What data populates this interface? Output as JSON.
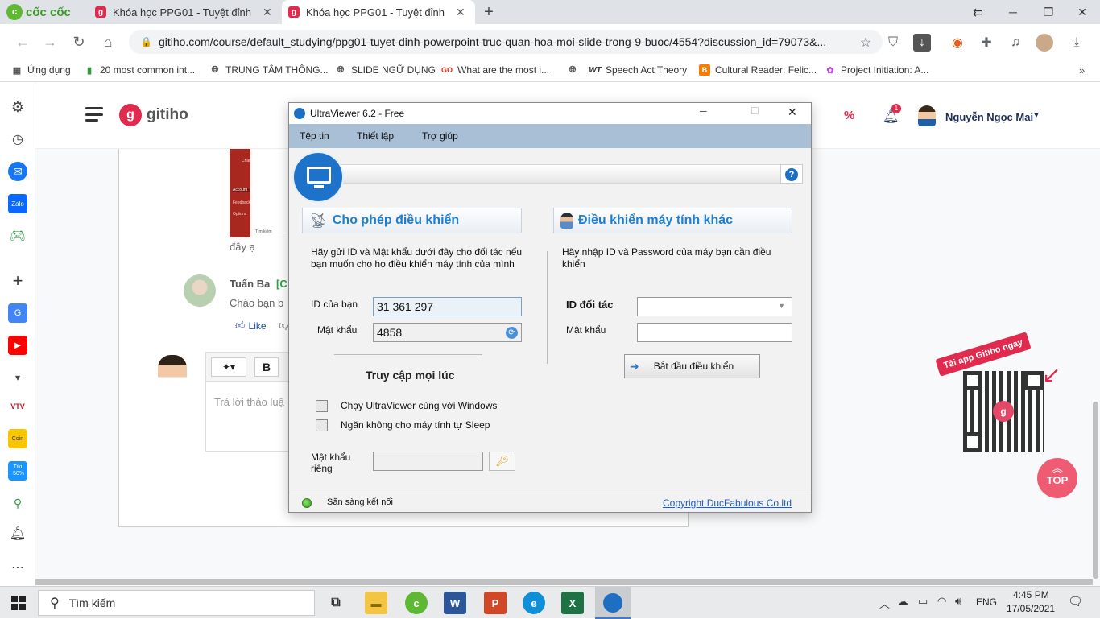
{
  "browser": {
    "brand": "cốc cốc",
    "tabs": [
      {
        "label": "Khóa học PPG01 - Tuyệt đỉnh",
        "active": false
      },
      {
        "label": "Khóa học PPG01 - Tuyệt đỉnh",
        "active": true
      }
    ],
    "url": "gitiho.com/course/default_studying/ppg01-tuyet-dinh-powerpoint-truc-quan-hoa-moi-slide-trong-9-buoc/4554?discussion_id=79073&...",
    "bookmarks": [
      {
        "label": "Ứng dụng"
      },
      {
        "label": "20 most common int..."
      },
      {
        "label": "TRUNG TÂM THÔNG..."
      },
      {
        "label": "SLIDE NGỮ DỤNG"
      },
      {
        "label": "What are the most i..."
      },
      {
        "label": "Speech Act Theory"
      },
      {
        "label": "Cultural Reader: Felic..."
      },
      {
        "label": "Project Initiation: A..."
      }
    ]
  },
  "gitiho": {
    "logo": "gitiho",
    "user": "Nguyễn Ngọc Mai",
    "notif_count": "1",
    "comment_image_text": "đây ạ",
    "commenter": "Tuấn Ba",
    "commenter_tag": "[C",
    "comment_text": "Chào bạn b",
    "like_label": "Like",
    "reply_placeholder": "Trả lời thảo luậ",
    "bold_label": "B",
    "app_promo": "Tải app Gitiho ngay",
    "top_label": "TOP",
    "menu_items": [
      "Chart",
      "Account",
      "Feedback",
      "Options"
    ],
    "thumb_search": "Tìm kiếm"
  },
  "ultraviewer": {
    "title": "UltraViewer 6.2 - Free",
    "menu": [
      "Tệp tin",
      "Thiết lập",
      "Trợ giúp"
    ],
    "allow_heading": "Cho phép điều khiển",
    "allow_desc": "Hãy gửi ID và Mật khẩu dưới đây cho đối tác nếu bạn muốn cho họ điều khiển máy tính của mình",
    "your_id_label": "ID của bạn",
    "your_id": "31 361 297",
    "password_label": "Mật khẩu",
    "password": "4858",
    "anytime_heading": "Truy cập mọi lúc",
    "opt_startup": "Chạy UltraViewer cùng với Windows",
    "opt_nosleep": "Ngăn không cho máy tính tự Sleep",
    "private_pw_label": "Mật khẩu riêng",
    "control_heading": "Điều khiển máy tính khác",
    "control_desc": "Hãy nhập ID và Password của máy bạn cần điều khiển",
    "partner_id_label": "ID đối tác",
    "partner_pw_label": "Mật khẩu",
    "start_button": "Bắt đầu điều khiển",
    "status": "Sẵn sàng kết nối",
    "copyright": "Copyright DucFabulous Co.ltd",
    "help_glyph": "?"
  },
  "taskbar": {
    "search_label": "Tìm kiếm",
    "language": "ENG",
    "time": "4:45 PM",
    "date": "17/05/2021"
  },
  "colors": {
    "accent": "#e02a4e",
    "uv_menu": "#a9bfd6",
    "uv_heading": "#1e7fd0"
  }
}
